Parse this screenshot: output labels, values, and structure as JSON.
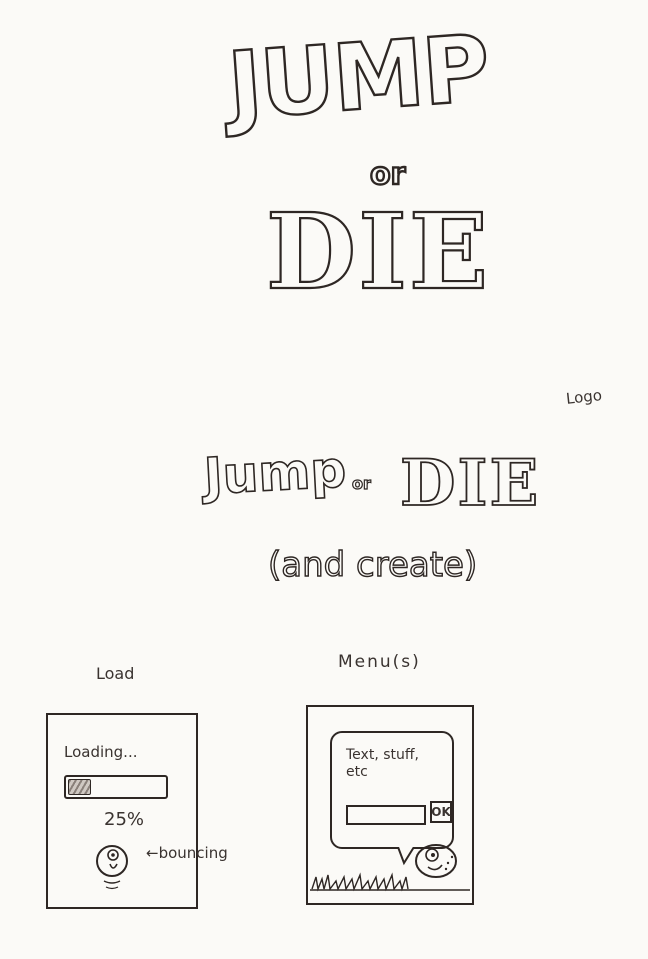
{
  "logo_big": {
    "jump": "JUMP",
    "or": "or",
    "die": "DIE"
  },
  "logo_label": "Logo",
  "logo_small": {
    "jump": "Jump",
    "or": "or",
    "die": "DIE",
    "subtitle": "(and create)"
  },
  "load": {
    "label": "Load",
    "loading_text": "Loading...",
    "progress": 0.25,
    "percent_text": "25%",
    "bouncing_note": "←bouncing"
  },
  "menu": {
    "label": "Menu(s)",
    "bubble_text": "Text, stuff, etc",
    "ok_label": "OK"
  }
}
